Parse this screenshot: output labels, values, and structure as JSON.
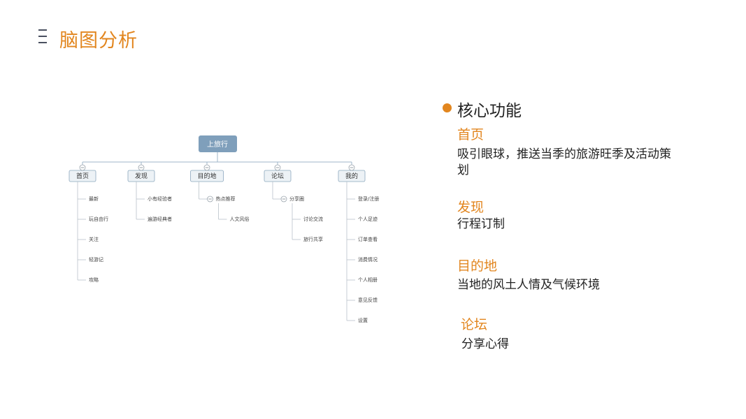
{
  "page": {
    "title": "脑图分析"
  },
  "mindmap": {
    "root": "上旅行",
    "branches": [
      {
        "label": "首页",
        "children": [
          {
            "label": "最新"
          },
          {
            "label": "玩自由行"
          },
          {
            "label": "关注"
          },
          {
            "label": "轻游记"
          },
          {
            "label": "攻略"
          }
        ]
      },
      {
        "label": "发现",
        "children": [
          {
            "label": "小有经验者"
          },
          {
            "label": "遍游经典者"
          }
        ]
      },
      {
        "label": "目的地",
        "children": [
          {
            "label": "热点推荐",
            "children": [
              {
                "label": "人文风俗"
              }
            ]
          }
        ]
      },
      {
        "label": "论坛",
        "children": [
          {
            "label": "分享圈",
            "children": [
              {
                "label": "讨论交流"
              },
              {
                "label": "旅行共享"
              }
            ]
          }
        ]
      },
      {
        "label": "我的",
        "children": [
          {
            "label": "登录/注册"
          },
          {
            "label": "个人足迹"
          },
          {
            "label": "订单查看"
          },
          {
            "label": "消费情况"
          },
          {
            "label": "个人相册"
          },
          {
            "label": "意见反馈"
          },
          {
            "label": "设置"
          }
        ]
      }
    ]
  },
  "panel": {
    "title": "核心功能",
    "sections": [
      {
        "title": "首页",
        "desc": "吸引眼球，推送当季的旅游旺季及活动策划"
      },
      {
        "title": "发现",
        "desc": "行程订制"
      },
      {
        "title": "目的地",
        "desc": "当地的风土人情及气候环境"
      },
      {
        "title": "论坛",
        "desc": "分享心得"
      }
    ]
  },
  "colors": {
    "accent": "#e2861f",
    "root_fill": "#7f9fbb",
    "node_fill": "#edf2f6",
    "node_border": "#8aa6bd",
    "line": "#9fb6c8"
  }
}
